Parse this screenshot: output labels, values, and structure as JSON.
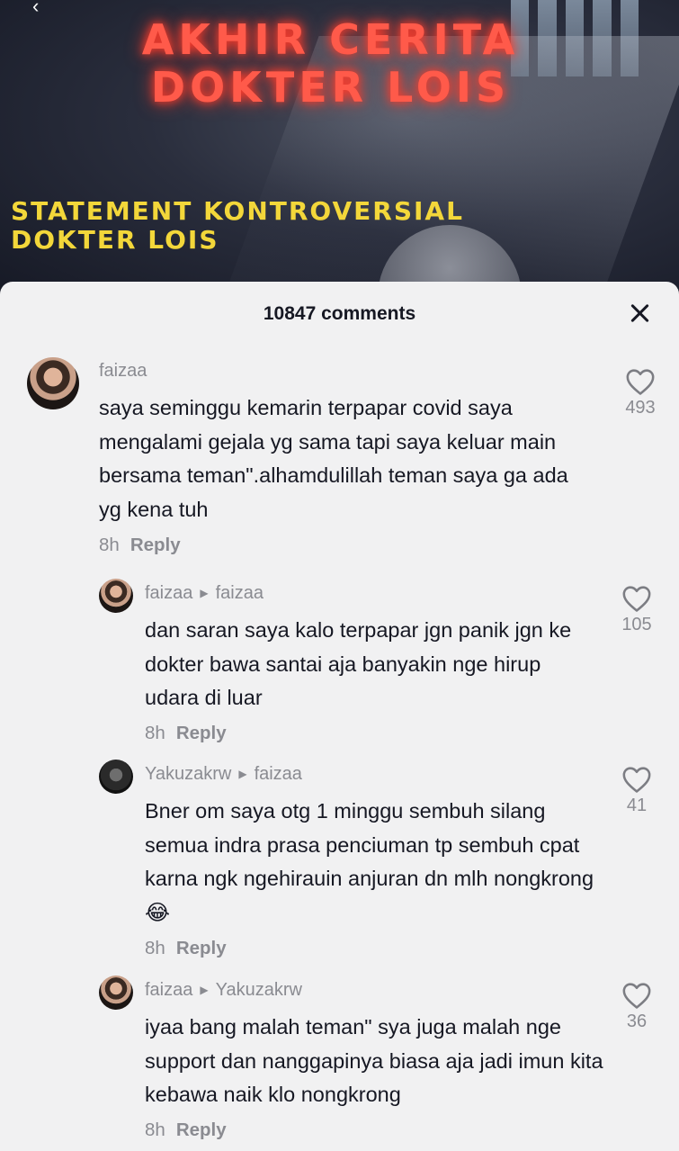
{
  "video": {
    "title_line1": "AKHIR CERITA",
    "title_line2": "DOKTER LOIS",
    "subtitle_line1": "STATEMENT KONTROVERSIAL",
    "subtitle_line2": "DOKTER LOIS"
  },
  "sheet": {
    "count_label": "10847 comments"
  },
  "comments": [
    {
      "user": "faizaa",
      "text": "saya seminggu kemarin terpapar covid saya mengalami gejala yg sama tapi saya keluar main bersama teman\".alhamdulillah teman saya ga ada yg kena tuh",
      "time": "8h",
      "reply": "Reply",
      "likes": "493"
    },
    {
      "user": "faizaa",
      "reply_to": "faizaa",
      "text": "dan saran saya kalo terpapar jgn panik jgn ke dokter bawa santai aja banyakin nge hirup udara di luar",
      "time": "8h",
      "reply": "Reply",
      "likes": "105"
    },
    {
      "user": "Yakuzakrw",
      "reply_to": "faizaa",
      "text": "Bner om saya otg 1 minggu sembuh silang semua indra prasa penciuman tp sembuh cpat karna ngk ngehirauin anjuran dn mlh nongkrong",
      "emoji": "😂",
      "time": "8h",
      "reply": "Reply",
      "likes": "41"
    },
    {
      "user": "faizaa",
      "reply_to": "Yakuzakrw",
      "text": "iyaa bang malah teman\" sya juga malah nge support dan nanggapinya biasa aja jadi imun kita kebawa naik klo nongkrong",
      "time": "8h",
      "reply": "Reply",
      "likes": "36"
    }
  ]
}
